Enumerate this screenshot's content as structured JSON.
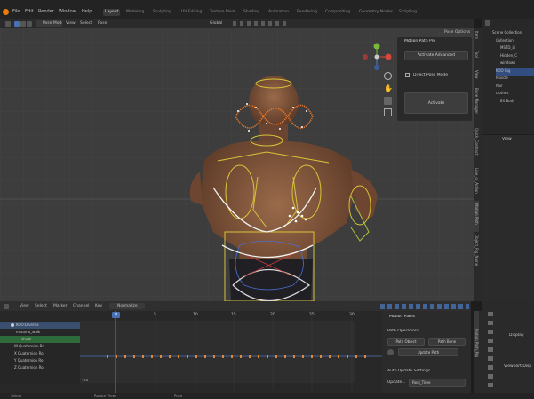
{
  "menu": [
    "File",
    "Edit",
    "Render",
    "Window",
    "Help"
  ],
  "workspaces": [
    "Layout",
    "Modeling",
    "Sculpting",
    "UV Editing",
    "Texture Paint",
    "Shading",
    "Animation",
    "Rendering",
    "Compositing",
    "Geometry Nodes",
    "Scripting"
  ],
  "viewport": {
    "mode": "Pose Mode",
    "menus": [
      "View",
      "Select",
      "Pose"
    ],
    "orientation": "Global",
    "pose_options": "Pose Options"
  },
  "mpp_panel": {
    "title": "Motion Path Pro",
    "activate_advanced": "Activate Advanced",
    "direct_pose_mode": "Direct Pose Mode",
    "activate": "Activate"
  },
  "viewport_tabs": [
    "Item",
    "Tool",
    "View",
    "Bone Manager",
    "Quick_Contract",
    "Line_of_Action",
    "Motion Path",
    "Object_Rig_Name"
  ],
  "outliner": {
    "title": "Scene Collection",
    "rows": [
      "Collection",
      "MSTD_Li",
      "Hidden_C",
      "windows",
      "KOO Rig",
      "Muscle",
      "hair",
      "clothes",
      "EX Body"
    ]
  },
  "props_header": "View",
  "dope": {
    "menus": [
      "View",
      "Select",
      "Marker",
      "Channel",
      "Key"
    ],
    "normalize": "Normalize",
    "current_frame": "0",
    "frames": [
      "5",
      "10",
      "15",
      "20",
      "25",
      "30"
    ],
    "scale_top": "10",
    "scale_bottom": "-10",
    "channels": [
      "KOO:Diventa",
      "mixamo_walk",
      "chest",
      "W Quaternion Ro",
      "X Quaternion Ro",
      "Y Quaternion Ro",
      "Z Quaternion Ro"
    ]
  },
  "motion_paths": {
    "title": "Motion Paths",
    "path_operations": "Path Operations",
    "path_object": "Path Object",
    "path_bone": "Path Bone",
    "update_path": "Update Path",
    "auto_update": "Auto Update Settings",
    "update_label": "Update...",
    "update_value": "Real_Time",
    "side_tab": "Motion Path_Pro"
  },
  "br_panel": {
    "display": "Display",
    "viewport_display": "Viewport Disp"
  },
  "status": {
    "select": "Select",
    "rotate_view": "Rotate View",
    "pose": "Pose"
  },
  "colors": {
    "accent_blue": "#4772b3",
    "keyframe_orange": "#e0883a",
    "rig_yellow": "#d6c43a",
    "path_white": "#f2f2f2",
    "playhead": "#5680c2"
  },
  "icons": [
    "play-icon",
    "eye-icon",
    "camera-icon",
    "hand-icon",
    "zoom-icon",
    "grid-icon",
    "filter-icon"
  ]
}
